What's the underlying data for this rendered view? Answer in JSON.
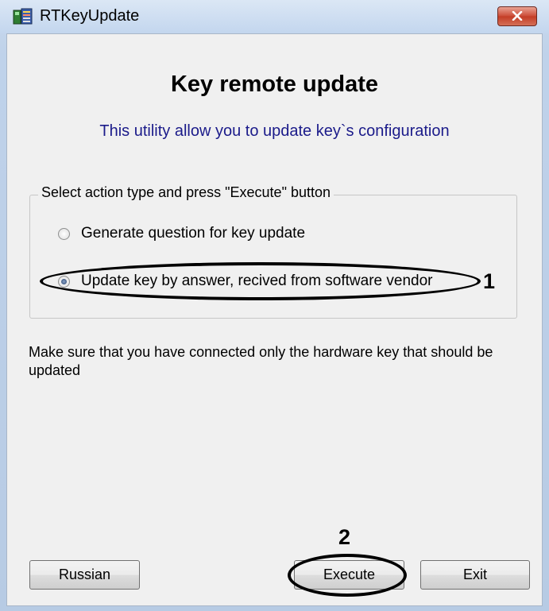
{
  "window": {
    "title": "RTKeyUpdate"
  },
  "header": {
    "heading": "Key remote update",
    "subtitle": "This utility allow you to update key`s configuration"
  },
  "action_group": {
    "legend": "Select action type and press \"Execute\" button",
    "options": [
      {
        "label": "Generate question for key update",
        "selected": false
      },
      {
        "label": "Update key by answer, recived from software vendor",
        "selected": true
      }
    ]
  },
  "note": "Make sure that you have connected only the hardware key that should be updated",
  "buttons": {
    "russian": "Russian",
    "execute": "Execute",
    "exit": "Exit"
  },
  "annotations": {
    "marker_1": "1",
    "marker_2": "2"
  },
  "colors": {
    "subtitle": "#1b1b8a",
    "close_button": "#c33c25",
    "annotation": "#000000"
  }
}
